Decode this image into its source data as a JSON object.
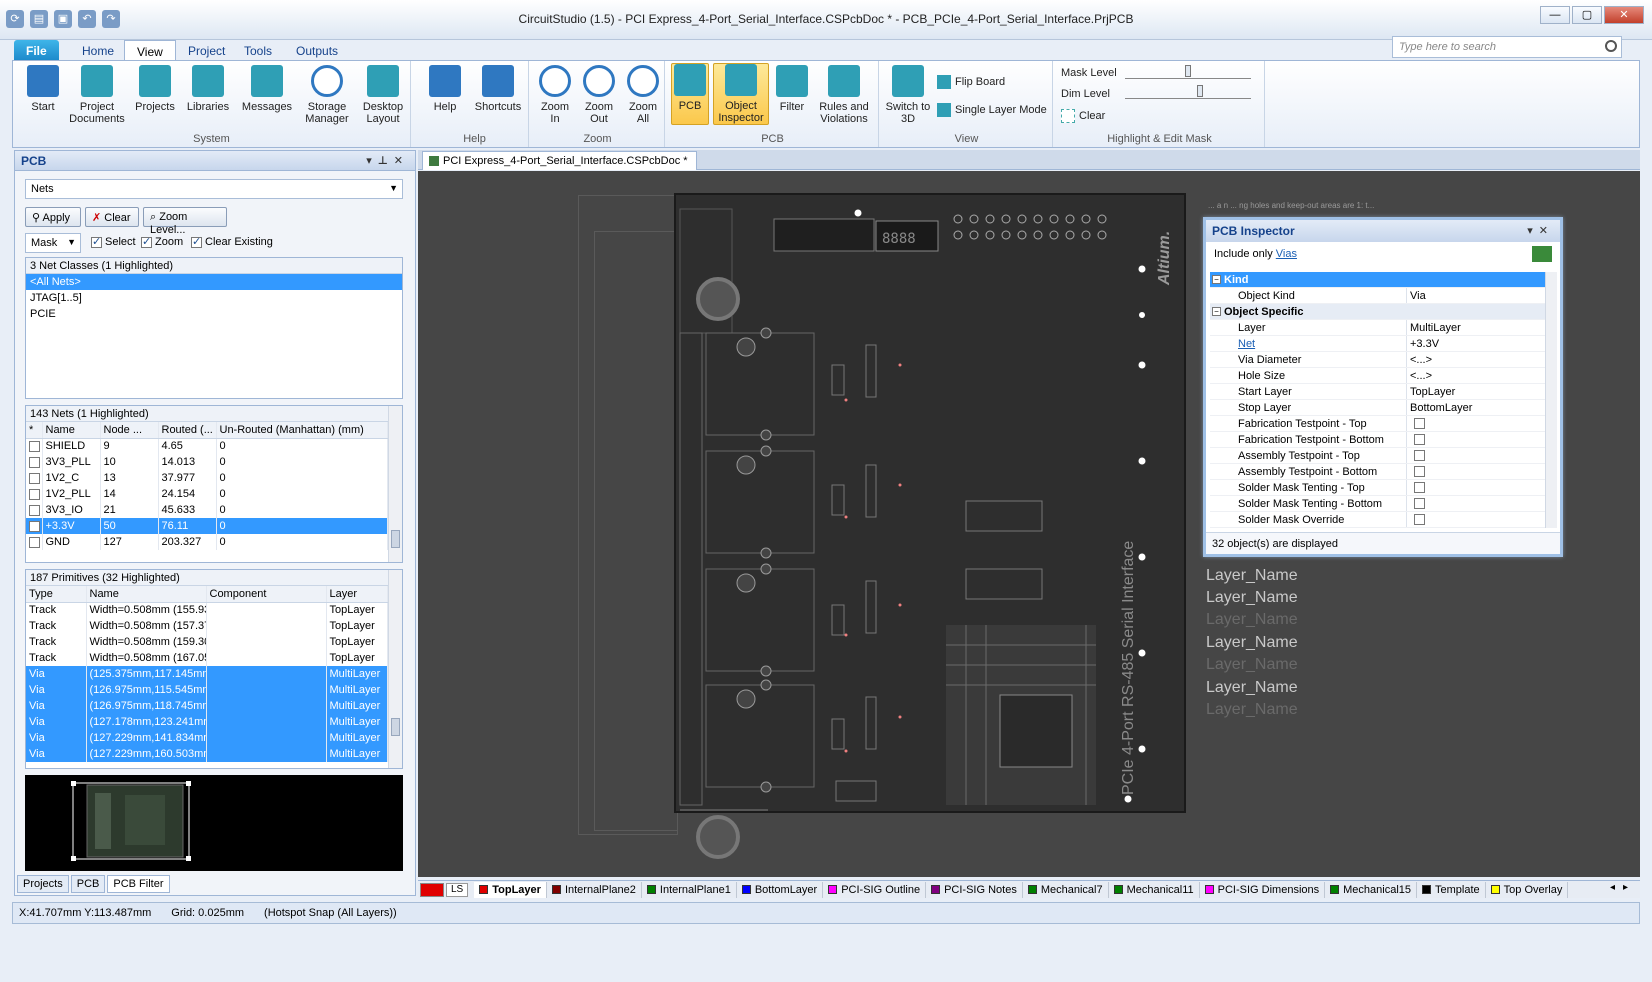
{
  "app": {
    "title": "CircuitStudio (1.5) - PCI Express_4-Port_Serial_Interface.CSPcbDoc * - PCB_PCIe_4-Port_Serial_Interface.PrjPCB",
    "search_placeholder": "Type here to search"
  },
  "tabs": [
    "File",
    "Home",
    "View",
    "Project",
    "Tools",
    "Outputs"
  ],
  "active_tab": "View",
  "ribbon": {
    "system": {
      "label": "System",
      "buttons": [
        "Start",
        "Project Documents",
        "Projects",
        "Libraries",
        "Messages",
        "Storage Manager",
        "Desktop Layout"
      ]
    },
    "help": {
      "label": "Help",
      "buttons": [
        "Help",
        "Shortcuts"
      ]
    },
    "zoom": {
      "label": "Zoom",
      "buttons": [
        "Zoom In",
        "Zoom Out",
        "Zoom All"
      ]
    },
    "pcb": {
      "label": "PCB",
      "buttons": [
        "PCB",
        "Object Inspector",
        "Filter",
        "Rules and Violations"
      ]
    },
    "view": {
      "label": "View",
      "switch": "Switch to 3D",
      "flip": "Flip Board",
      "single": "Single Layer Mode"
    },
    "mask": {
      "label": "Highlight & Edit Mask",
      "mask_level": "Mask Level",
      "dim_level": "Dim Level",
      "clear": "Clear"
    }
  },
  "panel": {
    "title": "PCB",
    "mode_select": "Nets",
    "apply": "Apply",
    "clear": "Clear",
    "zoom_level": "Zoom Level...",
    "mask_select": "Mask",
    "select": "Select",
    "zoom": "Zoom",
    "clear_existing": "Clear Existing",
    "net_classes_title": "3 Net Classes (1 Highlighted)",
    "net_classes": [
      "<All Nets>",
      "JTAG[1..5]",
      "PCIE"
    ],
    "nets_title": "143 Nets (1 Highlighted)",
    "nets_headers": [
      "*",
      "Name",
      "Node ...",
      "Routed (...",
      "Un-Routed (Manhattan) (mm)"
    ],
    "nets": [
      [
        "SHIELD",
        "9",
        "4.65",
        "0"
      ],
      [
        "3V3_PLL",
        "10",
        "14.013",
        "0"
      ],
      [
        "1V2_C",
        "13",
        "37.977",
        "0"
      ],
      [
        "1V2_PLL",
        "14",
        "24.154",
        "0"
      ],
      [
        "3V3_IO",
        "21",
        "45.633",
        "0"
      ],
      [
        "+3.3V",
        "50",
        "76.11",
        "0"
      ],
      [
        "GND",
        "127",
        "203.327",
        "0"
      ]
    ],
    "primitives_title": "187 Primitives (32 Highlighted)",
    "primitives_headers": [
      "Type",
      "Name",
      "Component",
      "Layer"
    ],
    "primitives": [
      [
        "Track",
        "Width=0.508mm (155.93",
        "",
        "TopLayer"
      ],
      [
        "Track",
        "Width=0.508mm (157.37",
        "",
        "TopLayer"
      ],
      [
        "Track",
        "Width=0.508mm (159.30",
        "",
        "TopLayer"
      ],
      [
        "Track",
        "Width=0.508mm (167.05",
        "",
        "TopLayer"
      ],
      [
        "Via",
        "(125.375mm,117.145mm)",
        "",
        "MultiLayer"
      ],
      [
        "Via",
        "(126.975mm,115.545mm)",
        "",
        "MultiLayer"
      ],
      [
        "Via",
        "(126.975mm,118.745mm)",
        "",
        "MultiLayer"
      ],
      [
        "Via",
        "(127.178mm,123.241mm)",
        "",
        "MultiLayer"
      ],
      [
        "Via",
        "(127.229mm,141.834mm)",
        "",
        "MultiLayer"
      ],
      [
        "Via",
        "(127.229mm,160.503mm)",
        "",
        "MultiLayer"
      ]
    ],
    "bottom_tabs": [
      "Projects",
      "PCB",
      "PCB Filter"
    ]
  },
  "document": {
    "tab": "PCI Express_4-Port_Serial_Interface.CSPcbDoc *",
    "board_label": "PCIe 4-Port RS-485 Serial Interface",
    "logo": "Altium.",
    "note": "... a n ... ng holes and keep-out areas are 1: t...",
    "layer_names": [
      "Layer_Name",
      "Layer_Name",
      "Layer_Name",
      "Layer_Name",
      "Layer_Name",
      "Layer_Name",
      "Layer_Name"
    ]
  },
  "inspector": {
    "title": "PCB Inspector",
    "include_prefix": "Include only",
    "include_link": "Vias",
    "kind_label": "Kind",
    "object_specific_label": "Object Specific",
    "rows": [
      {
        "k": "Object Kind",
        "v": "Via"
      },
      {
        "k": "Layer",
        "v": "MultiLayer"
      },
      {
        "k": "Net",
        "v": "+3.3V"
      },
      {
        "k": "Via Diameter",
        "v": "<...>"
      },
      {
        "k": "Hole Size",
        "v": "<...>"
      },
      {
        "k": "Start Layer",
        "v": "TopLayer"
      },
      {
        "k": "Stop Layer",
        "v": "BottomLayer"
      },
      {
        "k": "Fabrication Testpoint - Top",
        "v": ""
      },
      {
        "k": "Fabrication Testpoint - Bottom",
        "v": ""
      },
      {
        "k": "Assembly Testpoint - Top",
        "v": ""
      },
      {
        "k": "Assembly Testpoint - Bottom",
        "v": ""
      },
      {
        "k": "Solder Mask Tenting - Top",
        "v": ""
      },
      {
        "k": "Solder Mask Tenting - Bottom",
        "v": ""
      },
      {
        "k": "Solder Mask Override",
        "v": ""
      }
    ],
    "status": "32 object(s) are displayed"
  },
  "layers": {
    "ls": "LS",
    "tabs": [
      {
        "name": "TopLayer",
        "color": "#e00000"
      },
      {
        "name": "InternalPlane2",
        "color": "#800000"
      },
      {
        "name": "InternalPlane1",
        "color": "#008000"
      },
      {
        "name": "BottomLayer",
        "color": "#0000ff"
      },
      {
        "name": "PCI-SIG Outline",
        "color": "#ff00ff"
      },
      {
        "name": "PCI-SIG Notes",
        "color": "#800080"
      },
      {
        "name": "Mechanical7",
        "color": "#008000"
      },
      {
        "name": "Mechanical11",
        "color": "#008000"
      },
      {
        "name": "PCI-SIG Dimensions",
        "color": "#ff00ff"
      },
      {
        "name": "Mechanical15",
        "color": "#008000"
      },
      {
        "name": "Template",
        "color": "#000000"
      },
      {
        "name": "Top Overlay",
        "color": "#ffff00"
      }
    ]
  },
  "status": {
    "coords": "X:41.707mm Y:113.487mm",
    "grid": "Grid: 0.025mm",
    "snap": "(Hotspot Snap (All Layers))"
  }
}
